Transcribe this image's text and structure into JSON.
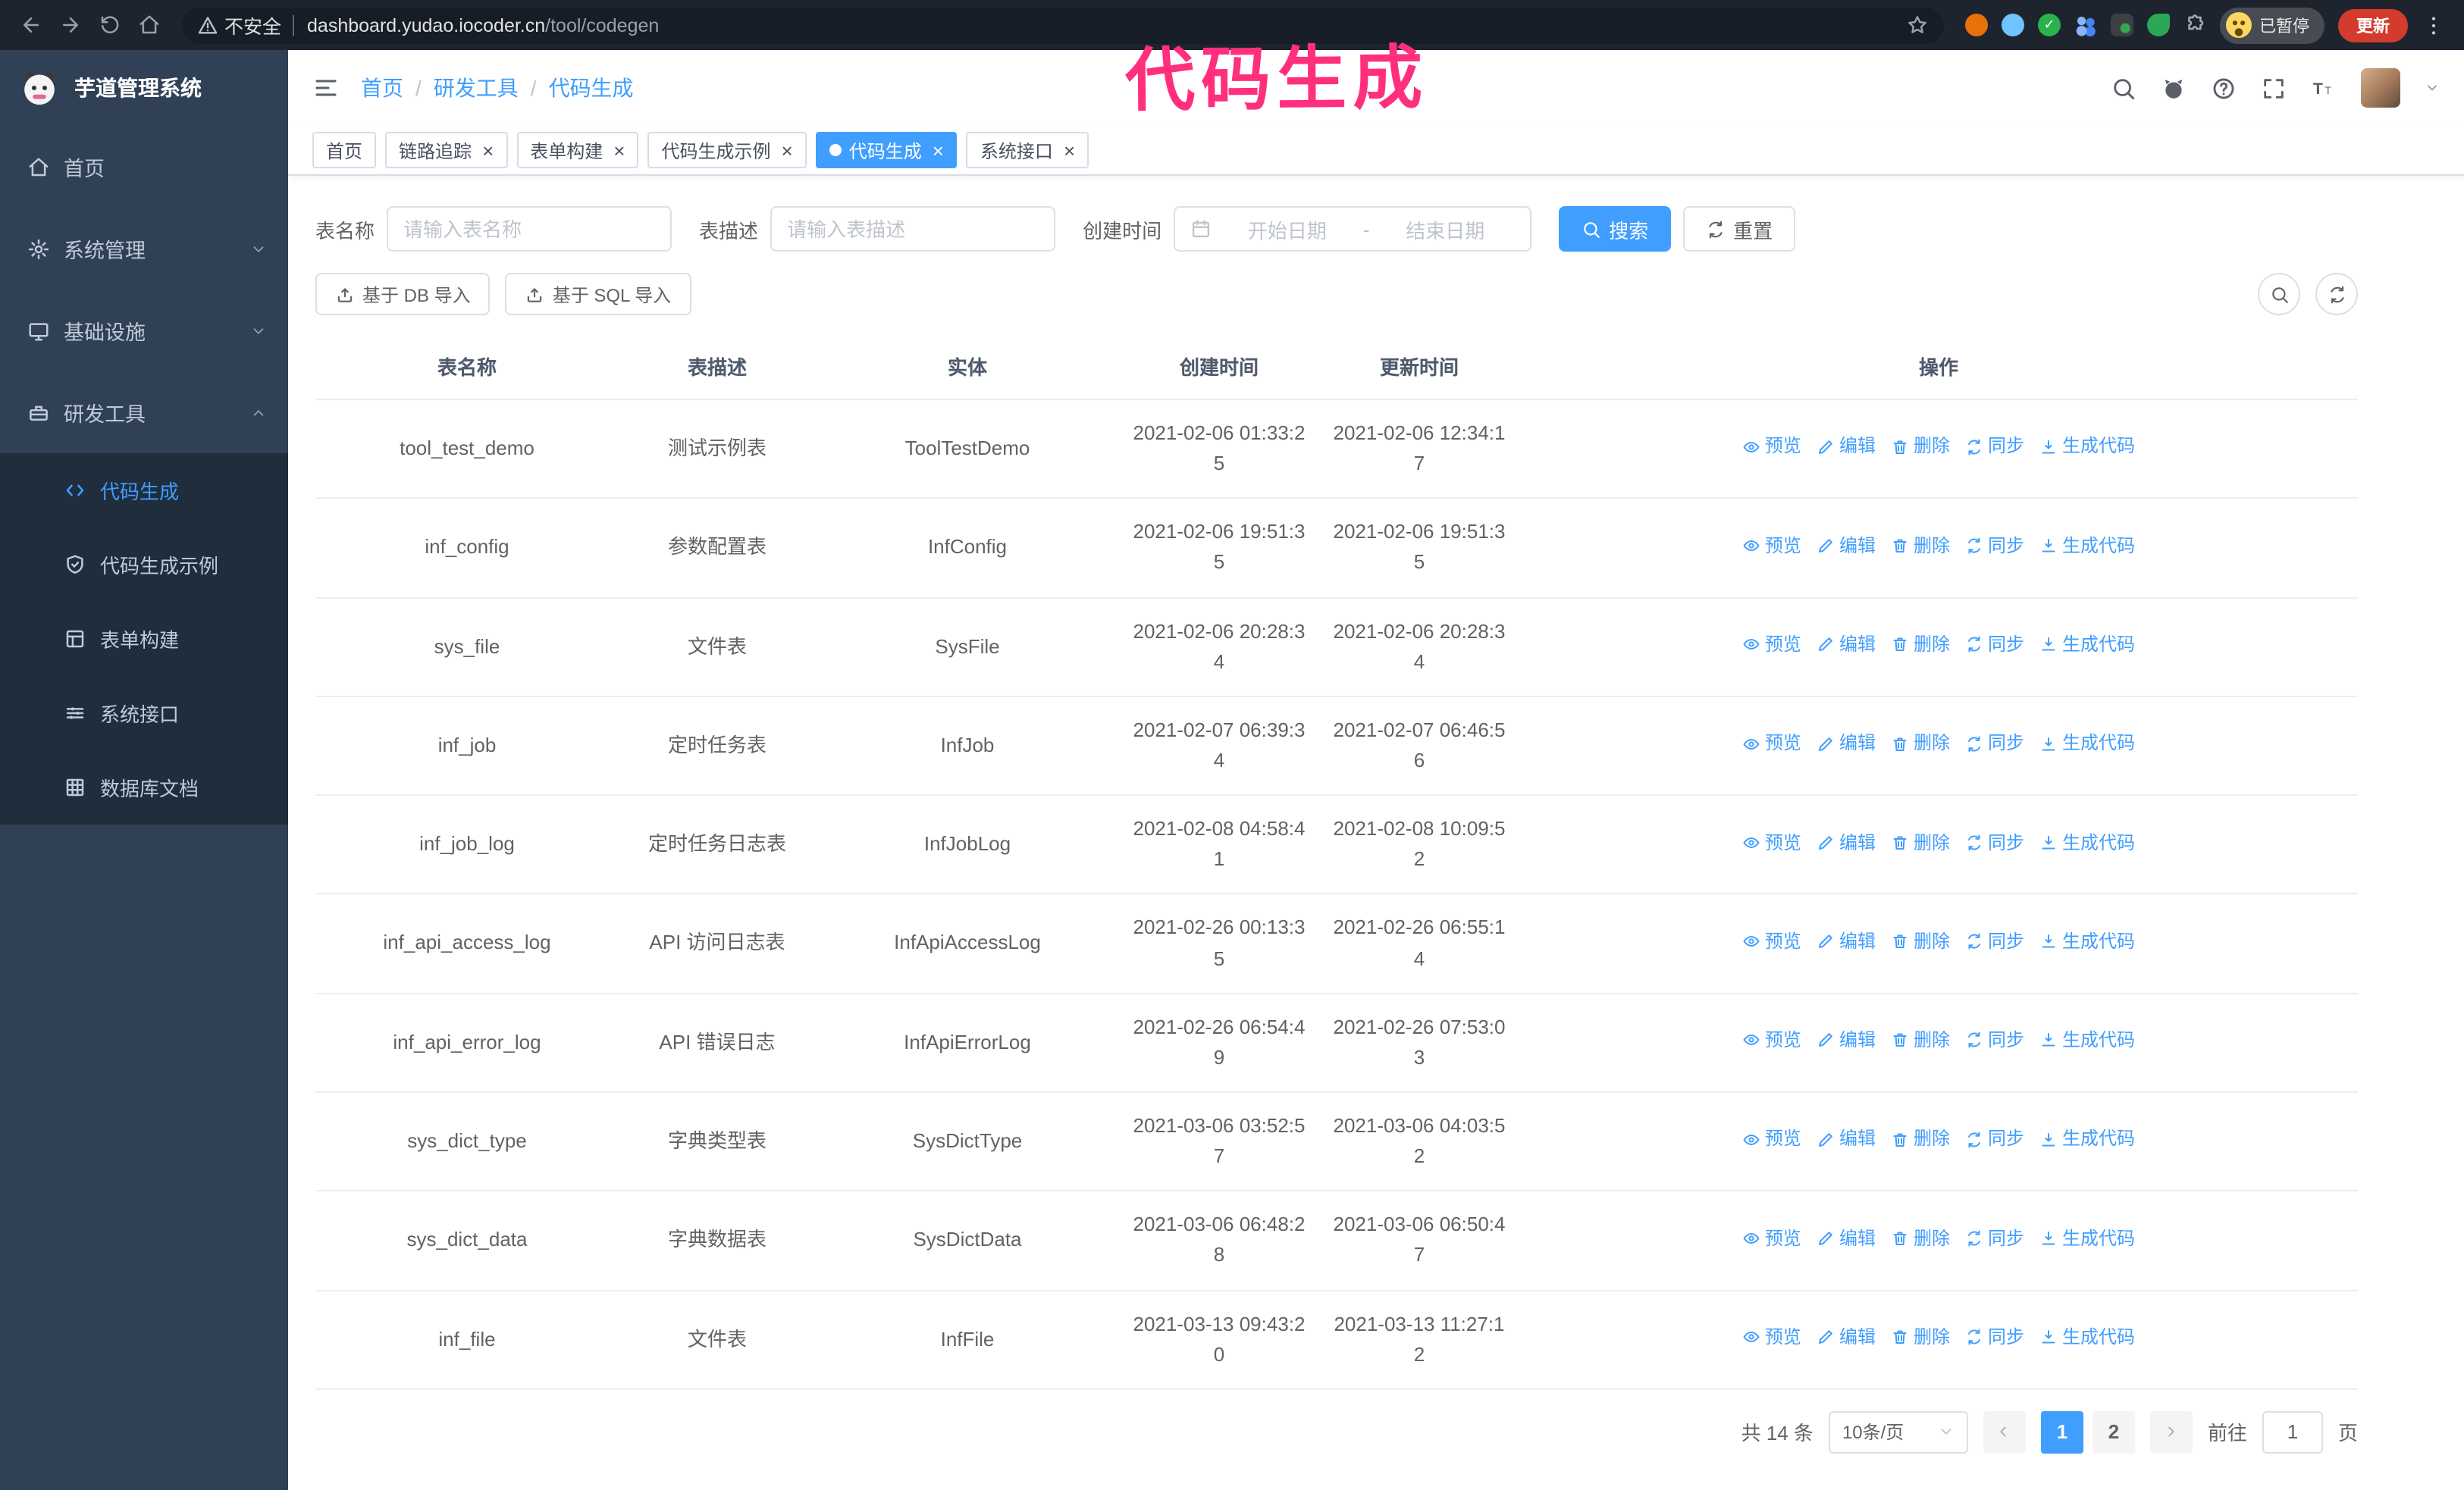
{
  "browser": {
    "security_text": "不安全",
    "url_host": "dashboard.yudao.iocoder.cn",
    "url_path": "/tool/codegen",
    "profile_badge": "已暂停",
    "update_button": "更新"
  },
  "annotation": {
    "text": "代码生成",
    "color": "#ff2f7e"
  },
  "sidebar": {
    "logo_title": "芋道管理系统",
    "items": [
      {
        "key": "home",
        "label": "首页",
        "icon": "home",
        "type": "root"
      },
      {
        "key": "system",
        "label": "系统管理",
        "icon": "gear",
        "type": "root",
        "chevron": "down"
      },
      {
        "key": "infra",
        "label": "基础设施",
        "icon": "infra",
        "type": "root",
        "chevron": "down"
      },
      {
        "key": "devtools",
        "label": "研发工具",
        "icon": "tools",
        "type": "root",
        "chevron": "up"
      },
      {
        "key": "codegen",
        "label": "代码生成",
        "icon": "code",
        "type": "sub",
        "active": true
      },
      {
        "key": "codegen-example",
        "label": "代码生成示例",
        "icon": "example",
        "type": "sub"
      },
      {
        "key": "form-builder",
        "label": "表单构建",
        "icon": "form",
        "type": "sub"
      },
      {
        "key": "system-api",
        "label": "系统接口",
        "icon": "api",
        "type": "sub"
      },
      {
        "key": "db-doc",
        "label": "数据库文档",
        "icon": "dbdoc",
        "type": "sub"
      }
    ]
  },
  "header": {
    "breadcrumb": [
      "首页",
      "研发工具",
      "代码生成"
    ]
  },
  "tabs": [
    {
      "key": "home",
      "label": "首页",
      "closable": false,
      "active": false
    },
    {
      "key": "tracer",
      "label": "链路追踪",
      "closable": true,
      "active": false
    },
    {
      "key": "form-builder",
      "label": "表单构建",
      "closable": true,
      "active": false
    },
    {
      "key": "codegen-example",
      "label": "代码生成示例",
      "closable": true,
      "active": false
    },
    {
      "key": "codegen",
      "label": "代码生成",
      "closable": true,
      "active": true
    },
    {
      "key": "system-api",
      "label": "系统接口",
      "closable": true,
      "active": false
    }
  ],
  "filters": {
    "table_name_label": "表名称",
    "table_name_placeholder": "请输入表名称",
    "table_desc_label": "表描述",
    "table_desc_placeholder": "请输入表描述",
    "create_time_label": "创建时间",
    "date_start_placeholder": "开始日期",
    "date_separator": "-",
    "date_end_placeholder": "结束日期",
    "search_label": "搜索",
    "reset_label": "重置"
  },
  "toolbar": {
    "import_db_label": "基于 DB 导入",
    "import_sql_label": "基于 SQL 导入"
  },
  "table": {
    "columns": [
      "表名称",
      "表描述",
      "实体",
      "创建时间",
      "更新时间",
      "操作"
    ],
    "action_labels": [
      "预览",
      "编辑",
      "删除",
      "同步",
      "生成代码"
    ],
    "rows": [
      {
        "name": "tool_test_demo",
        "desc": "测试示例表",
        "entity": "ToolTestDemo",
        "create_time": "2021-02-06 01:33:25",
        "update_time": "2021-02-06 12:34:17"
      },
      {
        "name": "inf_config",
        "desc": "参数配置表",
        "entity": "InfConfig",
        "create_time": "2021-02-06 19:51:35",
        "update_time": "2021-02-06 19:51:35"
      },
      {
        "name": "sys_file",
        "desc": "文件表",
        "entity": "SysFile",
        "create_time": "2021-02-06 20:28:34",
        "update_time": "2021-02-06 20:28:34"
      },
      {
        "name": "inf_job",
        "desc": "定时任务表",
        "entity": "InfJob",
        "create_time": "2021-02-07 06:39:34",
        "update_time": "2021-02-07 06:46:56"
      },
      {
        "name": "inf_job_log",
        "desc": "定时任务日志表",
        "entity": "InfJobLog",
        "create_time": "2021-02-08 04:58:41",
        "update_time": "2021-02-08 10:09:52"
      },
      {
        "name": "inf_api_access_log",
        "desc": "API 访问日志表",
        "entity": "InfApiAccessLog",
        "create_time": "2021-02-26 00:13:35",
        "update_time": "2021-02-26 06:55:14"
      },
      {
        "name": "inf_api_error_log",
        "desc": "API 错误日志",
        "entity": "InfApiErrorLog",
        "create_time": "2021-02-26 06:54:49",
        "update_time": "2021-02-26 07:53:03"
      },
      {
        "name": "sys_dict_type",
        "desc": "字典类型表",
        "entity": "SysDictType",
        "create_time": "2021-03-06 03:52:57",
        "update_time": "2021-03-06 04:03:52"
      },
      {
        "name": "sys_dict_data",
        "desc": "字典数据表",
        "entity": "SysDictData",
        "create_time": "2021-03-06 06:48:28",
        "update_time": "2021-03-06 06:50:47"
      },
      {
        "name": "inf_file",
        "desc": "文件表",
        "entity": "InfFile",
        "create_time": "2021-03-13 09:43:20",
        "update_time": "2021-03-13 11:27:12"
      }
    ]
  },
  "pagination": {
    "total_text": "共 14 条",
    "page_size": "10条/页",
    "pages": [
      "1",
      "2"
    ],
    "active_page": "1",
    "goto_label": "前往",
    "goto_value": "1",
    "goto_suffix": "页"
  },
  "colors": {
    "accent": "#409eff",
    "sidebar_bg": "#304156",
    "submenu_bg": "#1f2d3d"
  }
}
